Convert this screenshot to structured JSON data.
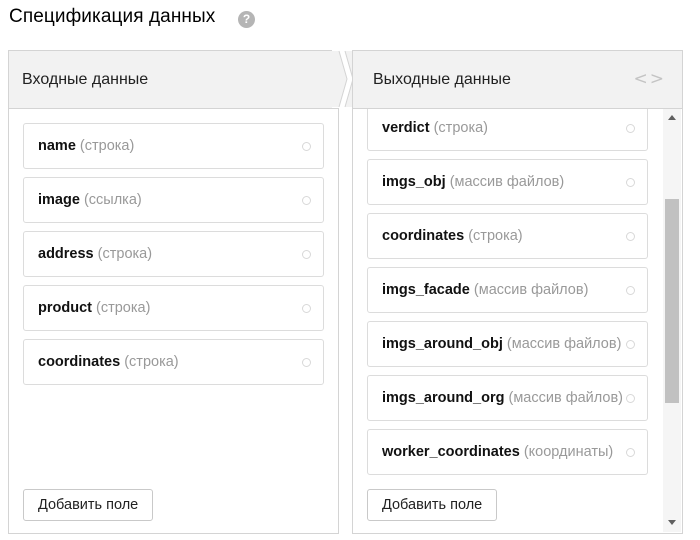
{
  "page": {
    "title": "Спецификация данных",
    "help_icon": "question-circle-icon",
    "help_glyph": "?"
  },
  "input_panel": {
    "header": "Входные данные",
    "fields": [
      {
        "name": "name",
        "type": "(строка)"
      },
      {
        "name": "image",
        "type": "(ссылка)"
      },
      {
        "name": "address",
        "type": "(строка)"
      },
      {
        "name": "product",
        "type": "(строка)"
      },
      {
        "name": "coordinates",
        "type": "(строка)"
      }
    ],
    "add_button": "Добавить поле"
  },
  "output_panel": {
    "header": "Выходные данные",
    "code_icon": "code-brackets-icon",
    "code_glyph": "<>",
    "fields": [
      {
        "name": "verdict",
        "type": "(строка)"
      },
      {
        "name": "imgs_obj",
        "type": "(массив файлов)"
      },
      {
        "name": "coordinates",
        "type": "(строка)"
      },
      {
        "name": "imgs_facade",
        "type": "(массив файлов)"
      },
      {
        "name": "imgs_around_obj",
        "type": "(массив файлов)"
      },
      {
        "name": "imgs_around_org",
        "type": "(массив файлов)"
      },
      {
        "name": "worker_coordinates",
        "type": "(координаты)"
      }
    ],
    "add_button": "Добавить поле"
  },
  "colors": {
    "header_bg": "#f2f2f2",
    "border": "#d4d4d4",
    "type_text": "#999999",
    "scroll_thumb": "#c1c1c1"
  }
}
